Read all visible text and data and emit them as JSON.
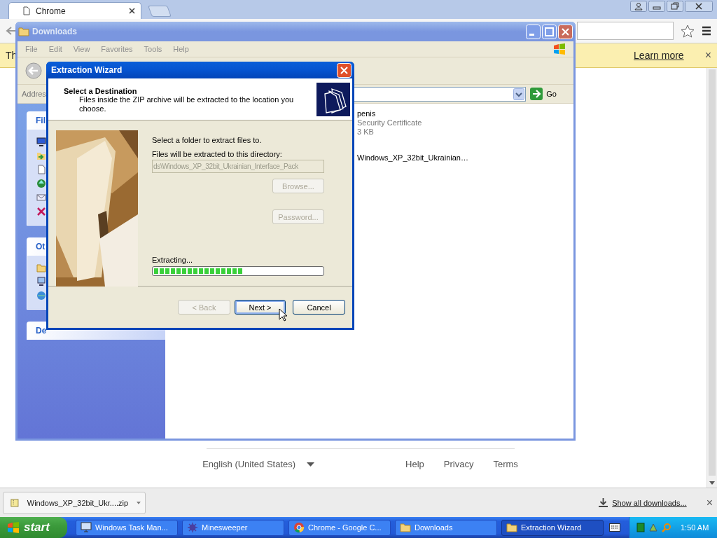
{
  "chrome": {
    "tab": {
      "title": "Chrome",
      "selected": true
    },
    "infobar": {
      "text": "Th",
      "link": "Learn more",
      "close": "×"
    },
    "footer": {
      "language": "English (United States)",
      "links": [
        "Help",
        "Privacy",
        "Terms"
      ]
    },
    "download_shelf": {
      "item": "Windows_XP_32bit_Ukr....zip",
      "show_all": "Show all downloads...",
      "close": "×"
    }
  },
  "explorer": {
    "title": "Downloads",
    "menu": [
      "File",
      "Edit",
      "View",
      "Favorites",
      "Tools",
      "Help"
    ],
    "address_label": "Addres",
    "go": "Go",
    "sidebar_panels": [
      "Fil",
      "Ot",
      "De"
    ],
    "files": [
      {
        "name": "penis",
        "type": "Security Certificate",
        "size": "3 KB"
      },
      {
        "name": "Windows_XP_32bit_Ukrainian…"
      }
    ]
  },
  "wizard": {
    "title": "Extraction Wizard",
    "heading": "Select a Destination",
    "description": "Files inside the ZIP archive will be extracted to the location you choose.",
    "prompt": "Select a folder to extract files to.",
    "directory_label": "Files will be extracted to this directory:",
    "directory": {
      "value": "ds\\Windows_XP_32bit_Ukrainian_Interface_Pack",
      "disabled": true
    },
    "side_buttons": [
      {
        "label": "Browse...",
        "disabled": true
      },
      {
        "label": "Password...",
        "disabled": true
      }
    ],
    "progress": {
      "label": "Extracting...",
      "level": 0.53
    },
    "buttons": [
      {
        "label": "< Back",
        "disabled": true,
        "default": false
      },
      {
        "label": "Next >",
        "disabled": false,
        "default": true
      },
      {
        "label": "Cancel",
        "disabled": false,
        "default": false
      }
    ]
  },
  "taskbar": {
    "start": "start",
    "items": [
      {
        "label": "Windows Task Man...",
        "kind": "monitor",
        "selected": false
      },
      {
        "label": "Minesweeper",
        "kind": "mine",
        "selected": false
      },
      {
        "label": "Chrome - Google C...",
        "kind": "chrome",
        "selected": false
      },
      {
        "label": "Downloads",
        "kind": "folder",
        "selected": false
      },
      {
        "label": "Extraction Wizard",
        "kind": "folder",
        "selected": true
      }
    ],
    "clock": "1:50 AM"
  }
}
